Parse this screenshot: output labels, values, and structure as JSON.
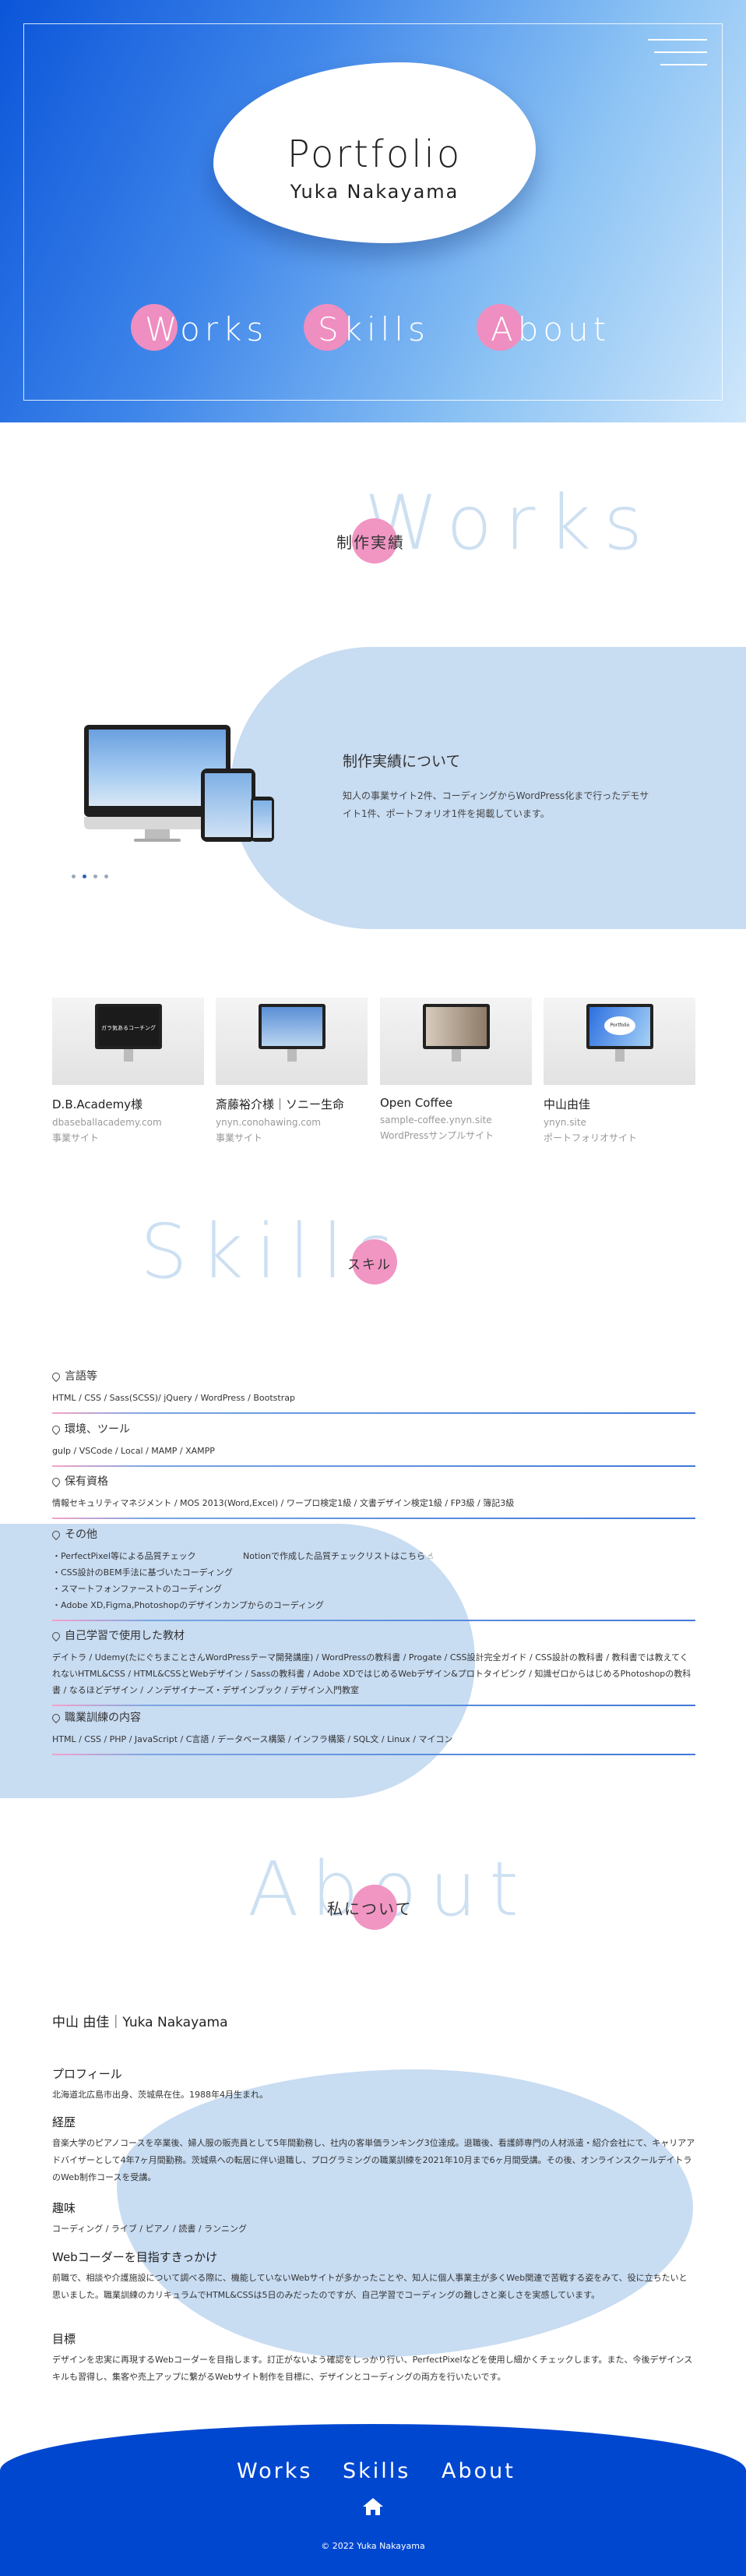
{
  "hero": {
    "title": "Portfolio",
    "subtitle": "Yuka Nakayama",
    "nav": [
      "Works",
      "Skills",
      "About"
    ],
    "menu_icon": "hamburger-icon"
  },
  "works": {
    "heading_en": "Works",
    "heading_jp": "制作実績",
    "feature_title": "制作実績について",
    "feature_desc": "知人の事業サイト2件、コーディングからWordPress化まで行ったデモサイト1件、ポートフォリオ1件を掲載しています。",
    "cards": [
      {
        "title": "D.B.Academy様",
        "url": "dbaseballacademy.com",
        "type": "事業サイト"
      },
      {
        "title": "斎藤裕介様｜ソニー生命",
        "url": "ynyn.conohawing.com",
        "type": "事業サイト"
      },
      {
        "title": "Open Coffee",
        "url": "sample-coffee.ynyn.site",
        "type": "WordPressサンプルサイト"
      },
      {
        "title": "中山由佳",
        "url": "ynyn.site",
        "type": "ポートフォリオサイト"
      }
    ],
    "card1_screen_text": "ガラ気あるコーチング",
    "card4_screen_text": "Portfolio"
  },
  "skills": {
    "heading_en": "Skills",
    "heading_jp": "スキル",
    "items": [
      {
        "title": "言語等",
        "body": "HTML / CSS / Sass(SCSS)/ jQuery / WordPress / Bootstrap"
      },
      {
        "title": "環境、ツール",
        "body": "gulp / VSCode / Local / MAMP / XAMPP"
      },
      {
        "title": "保有資格",
        "body": "情報セキュリティマネジメント / MOS 2013(Word,Excel) / ワープロ検定1級 / 文書デザイン検定1級 / FP3級 / 簿記3級"
      },
      {
        "title": "その他",
        "body_lines": [
          "・PerfectPixel等による品質チェック",
          "・CSS設計のBEM手法に基づいたコーディング",
          "・スマートフォンファーストのコーディング",
          "・Adobe XD,Figma,Photoshopのデザインカンプからのコーディング"
        ],
        "link": "Notionで作成した品質チェックリストはこちら"
      },
      {
        "title": "自己学習で使用した教材",
        "body": "デイトラ / Udemy(たにぐちまことさんWordPressテーマ開発講座) / WordPressの教科書 / Progate / CSS設計完全ガイド / CSS設計の教科書 / 教科書では教えてくれないHTML&CSS / HTML&CSSとWebデザイン / Sassの教科書 / Adobe XDではじめるWebデザイン&プロトタイピング / 知識ゼロからはじめるPhotoshopの教科書 / なるほどデザイン / ノンデザイナーズ・デザインブック / デザイン入門教室"
      },
      {
        "title": "職業訓練の内容",
        "body": "HTML / CSS / PHP / JavaScript / C言語 / データベース構築 / インフラ構築 / SQL文 / Linux / マイコン"
      }
    ]
  },
  "about": {
    "heading_en": "About",
    "heading_jp": "私について",
    "name": "中山 由佳｜Yuka Nakayama",
    "sections": [
      {
        "title": "プロフィール",
        "body": "北海道北広島市出身、茨城県在住。1988年4月生まれ。"
      },
      {
        "title": "経歴",
        "body": "音楽大学のピアノコースを卒業後、婦人服の販売員として5年間勤務し、社内の客単価ランキング3位達成。退職後、看護師専門の人材派遣・紹介会社にて、キャリアアドバイザーとして4年7ヶ月間勤務。茨城県への転居に伴い退職し、プログラミングの職業訓練を2021年10月まで6ヶ月間受講。その後、オンラインスクールデイトラのWeb制作コースを受講。"
      },
      {
        "title": "趣味",
        "body": "コーディング / ライブ / ピアノ / 読書 / ランニング"
      },
      {
        "title": "Webコーダーを目指すきっかけ",
        "body": "前職で、相談や介護施設について調べる際に、機能していないWebサイトが多かったことや、知人に個人事業主が多くWeb関連で苦戦する姿をみて、役に立ちたいと思いました。職業訓練のカリキュラムでHTML&CSSは5日のみだったのですが、自己学習でコーディングの難しさと楽しさを実感しています。"
      },
      {
        "title": "目標",
        "body": "デザインを忠実に再現するWebコーダーを目指します。訂正がないよう確認をしっかり行い、PerfectPixelなどを使用し細かくチェックします。また、今後デザインスキルも習得し、集客や売上アップに繋がるWebサイト制作を目標に、デザインとコーディングの両方を行いたいです。"
      }
    ]
  },
  "footer": {
    "nav": [
      "Works",
      "Skills",
      "About"
    ],
    "home_icon": "home-icon",
    "copyright": "© 2022 Yuka Nakayama"
  },
  "colors": {
    "hero_blue": "#0b55d9",
    "light_blue": "#c8dcf2",
    "pink": "#f195c3",
    "footer_blue": "#0047d0"
  }
}
